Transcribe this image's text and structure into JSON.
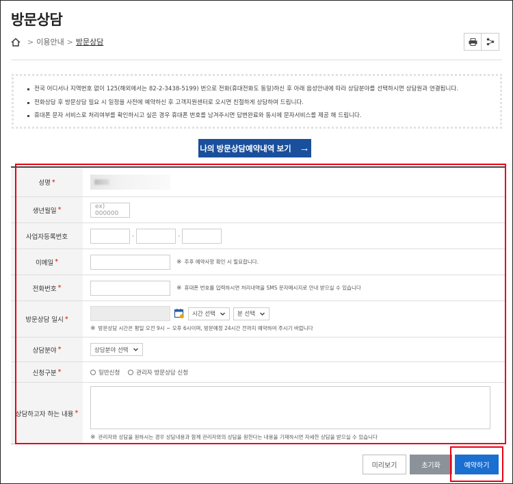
{
  "page": {
    "title": "방문상담"
  },
  "breadcrumb": {
    "sep1": ">",
    "item1": "이용안내",
    "sep2": ">",
    "current": "방문상담"
  },
  "icons": {
    "home": "home-icon",
    "print": "print-icon",
    "share": "share-icon",
    "calendar": "calendar-icon",
    "arrow": "arrow-right-icon",
    "chevron": "chevron-down-icon"
  },
  "notice": [
    "전국 어디서나 지역번호 없이 125(해외에서는 82-2-3438-5199) 번으로 전화(휴대전화도 동일)하신 후 아래 음성안내에 따라 상담분야를 선택하시면 상담원과 연결됩니다.",
    "전화상담 후 방문상담 필요 시 일정을 사전에 예약하신 후 고객지원센터로 오시면 친절하게 상담하여 드립니다.",
    "휴대폰 문자 서비스로 처리여부를 확인하시고 싶은 경우 휴대폰 번호를 남겨주시면 답변완료와 동시에 문자서비스를 제공 해 드립니다."
  ],
  "history_button": {
    "label": "나의 방문상담예약내역 보기",
    "arrow": "→"
  },
  "form": {
    "required_mark": "*",
    "name": {
      "label": "성명"
    },
    "birth": {
      "label": "생년월일",
      "placeholder": "ex) 000000"
    },
    "biz": {
      "label": "사업자등록번호",
      "dash": "-"
    },
    "email": {
      "label": "이메일",
      "note_mark": "※",
      "note": "추후 예약사항 확인 시 필요합니다."
    },
    "phone": {
      "label": "전화번호",
      "note_mark": "※",
      "note": "휴대폰 번호를 입력하시면 처리내역을 SMS 문자메시지로 안내 받으실 수 있습니다"
    },
    "visit": {
      "label": "방문상담 일시",
      "time_select": "시간 선택",
      "minute_select": "분 선택",
      "note_mark": "※",
      "note": "방문상담 시간은 평일 오전 9시 ~ 오후 6시이며, 방문예정 24시간 전까지 예약하여 주시기 바랍니다"
    },
    "field": {
      "label": "상담분야",
      "select": "상담분야 선택"
    },
    "apply_type": {
      "label": "신청구분",
      "option1": "일반신청",
      "option2": "관리자 방문상담 신청"
    },
    "content": {
      "label": "상담하고자 하는 내용",
      "note_mark": "※",
      "note": "관리자와 상담을 원하시는 경우 상담내용과 함께 관리자와의 상담을 원한다는 내용을 기재하시면 자세한 상담을 받으실 수 있습니다"
    }
  },
  "buttons": {
    "preview": "미리보기",
    "reset": "초기화",
    "submit": "예약하기"
  },
  "colors": {
    "primary": "#1a4f9c",
    "submit": "#1a6fd1",
    "reset": "#8b9299",
    "highlight": "#e60012"
  }
}
